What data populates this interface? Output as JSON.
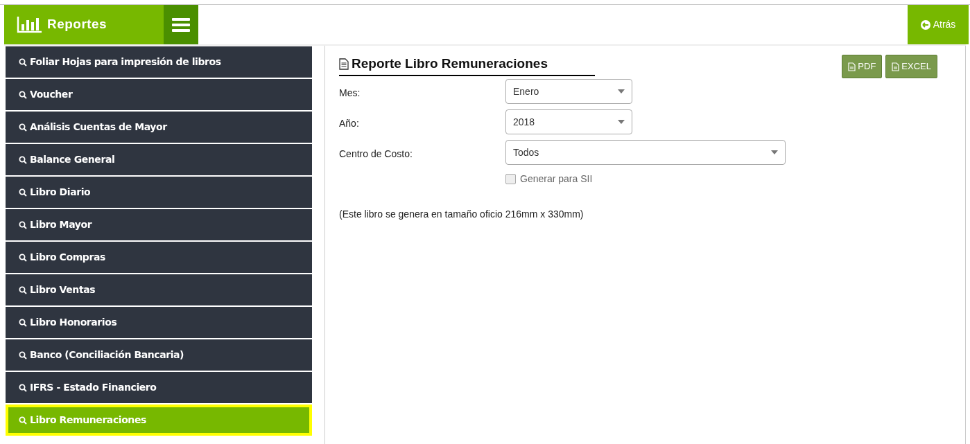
{
  "header": {
    "title": "Reportes",
    "back_button": "Atrás"
  },
  "sidebar": {
    "items": [
      {
        "label": "Foliar Hojas para impresión de libros",
        "selected": false
      },
      {
        "label": "Voucher",
        "selected": false
      },
      {
        "label": "Análisis Cuentas de Mayor",
        "selected": false
      },
      {
        "label": "Balance General",
        "selected": false
      },
      {
        "label": "Libro Diario",
        "selected": false
      },
      {
        "label": "Libro Mayor",
        "selected": false
      },
      {
        "label": "Libro Compras",
        "selected": false
      },
      {
        "label": "Libro Ventas",
        "selected": false
      },
      {
        "label": "Libro Honorarios",
        "selected": false
      },
      {
        "label": "Banco (Conciliación Bancaria)",
        "selected": false
      },
      {
        "label": "IFRS - Estado Financiero",
        "selected": false
      },
      {
        "label": "Libro Remuneraciones",
        "selected": true
      }
    ]
  },
  "report": {
    "title": "Reporte Libro Remuneraciones",
    "export_buttons": [
      "PDF",
      "EXCEL"
    ],
    "fields": [
      {
        "label": "Mes:",
        "value": "Enero",
        "wide": false
      },
      {
        "label": "Año:",
        "value": "2018",
        "wide": false
      },
      {
        "label": "Centro de Costo:",
        "value": "Todos",
        "wide": true
      }
    ],
    "checkbox": {
      "label": "Generar para SII",
      "checked": false
    },
    "note": "(Este libro se genera en tamaño oficio 216mm x 330mm)"
  }
}
